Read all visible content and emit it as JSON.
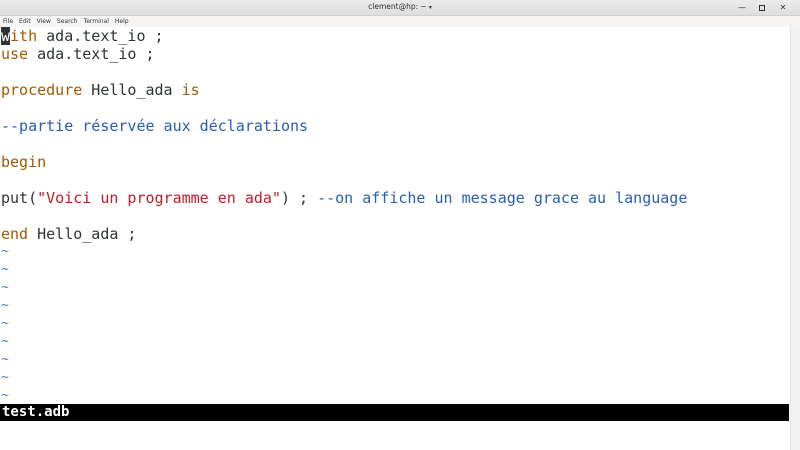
{
  "window": {
    "title": "clement@hp: ~",
    "title_caret": "▾",
    "min_glyph": "—",
    "close_glyph": "✕"
  },
  "menu": [
    "File",
    "Edit",
    "View",
    "Search",
    "Terminal",
    "Help"
  ],
  "code": {
    "line1": {
      "kw": "with",
      "rest": " ada.text_io ;"
    },
    "line2": {
      "kw": "use",
      "rest": " ada.text_io ;"
    },
    "line3": {
      "kw1": "procedure",
      "name": " Hello_ada ",
      "kw2": "is"
    },
    "line4": {
      "comment": "--partie réservée aux déclarations"
    },
    "line5": {
      "kw": "begin"
    },
    "line6": {
      "call": "put(",
      "string": "\"Voici un programme en ada\"",
      "close": ") ; ",
      "comment": "--on affiche un message grace au language"
    },
    "line7": {
      "kw": "end",
      "rest": " Hello_ada ;"
    }
  },
  "empty_line_marker": "~",
  "status_line": "test.adb",
  "colors": {
    "keyword": "#a05a00",
    "string": "#c01c28",
    "comment": "#2a5db0",
    "tilde": "#4a7fc1"
  }
}
